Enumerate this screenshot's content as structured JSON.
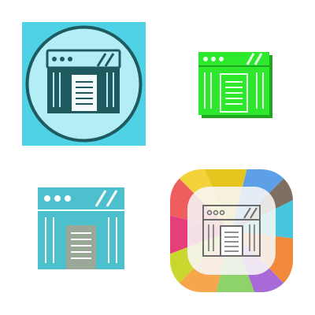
{
  "icon_set": {
    "subject": "web-browser-page-icon",
    "variants": [
      {
        "style": "filled-circle-on-square",
        "colors": {
          "square": "#4fd2e6",
          "circle": "#b3eef7",
          "ring": "#1e5a5e",
          "glyph": "#1e5a5e",
          "paper": "#f4fbfc"
        }
      },
      {
        "style": "solid-green",
        "colors": {
          "fill": "#2ee82e",
          "shadow": "#1fa81f",
          "lines": "#e8ffe8"
        }
      },
      {
        "style": "flat-color",
        "colors": {
          "window": "#4cc0cc",
          "lines": "#ffffff",
          "paper": "#9aa897",
          "paper_lines": "#ffffff"
        }
      },
      {
        "style": "multicolor-rounded-badge",
        "colors": {
          "segments": [
            "#f4d23c",
            "#f7a64b",
            "#ef5e5e",
            "#e43f7a",
            "#a86ad6",
            "#5da0e8",
            "#47c7de",
            "#7f6f63",
            "#8dd36a",
            "#f08a3a",
            "#e6c51f",
            "#c9d72e"
          ],
          "center": "#f7f7f7",
          "glyph": "#6b6b6b"
        }
      }
    ]
  }
}
